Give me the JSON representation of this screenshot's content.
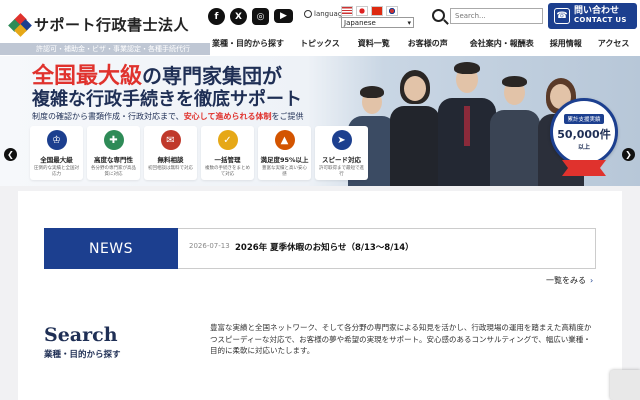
{
  "header": {
    "logo_text": "サポート行政書士法人",
    "sns": [
      {
        "name": "facebook",
        "glyph": "f"
      },
      {
        "name": "x",
        "glyph": "X"
      },
      {
        "name": "instagram",
        "glyph": "◎"
      },
      {
        "name": "youtube",
        "glyph": "▶"
      }
    ],
    "language_label": "language",
    "language_selected": "Japanese",
    "search_placeholder": "Search...",
    "contact_jp": "問い合わせ",
    "contact_en": "CONTACT US",
    "accent": "#1c3f8f"
  },
  "nav": [
    "業種・目的から探す",
    "トピックス",
    "資料一覧",
    "お客様の声",
    "会社案内・報酬表",
    "採用情報",
    "アクセス"
  ],
  "hero": {
    "scroll_text": "許認可・補助金・ビザ・事業認定・各種手続代行",
    "line1_red": "全国最大級",
    "line1_rest": "の専門家集団が",
    "line2": "複雑な行政手続きを徹底サポート",
    "sub_pre": "制度の確認から書類作成・行政対応まで、",
    "sub_hl": "安心して進められる体制",
    "sub_post": "をご提供",
    "features": [
      {
        "title": "全国最大級",
        "desc": "圧倒的な実績と全国対応力",
        "color": "#1c3f8f",
        "glyph": "♔"
      },
      {
        "title": "高度な専門性",
        "desc": "各分野の専門家が高品質に対応",
        "color": "#2e8b57",
        "glyph": "✚"
      },
      {
        "title": "無料相談",
        "desc": "初回相談は無料で対応",
        "color": "#c0392b",
        "glyph": "✉"
      },
      {
        "title": "一括管理",
        "desc": "複数の手続きをまとめて対応",
        "color": "#e6a817",
        "glyph": "✓"
      },
      {
        "title": "満足度95%以上",
        "desc": "豊富な実績と高い安心感",
        "color": "#d35400",
        "glyph": "▲"
      },
      {
        "title": "スピード対応",
        "desc": "許可取得まで最短で進行",
        "color": "#1c3f8f",
        "glyph": "➤"
      }
    ],
    "badge_top": "累計支援実績",
    "badge_num": "50,000件",
    "badge_bot": "以上",
    "prev": "❮",
    "next": "❯"
  },
  "news": {
    "label": "NEWS",
    "date": "2026-07-13",
    "title": "2026年 夏季休暇のお知らせ（8/13〜8/14）",
    "more": "一覧をみる",
    "more_chev": "›"
  },
  "search": {
    "heading": "Search",
    "sub": "業種・目的から探す",
    "desc": "豊富な実績と全国ネットワーク、そして各分野の専門家による知見を活かし、行政現場の運用を踏まえた高精度かつスピーディーな対応で、お客様の夢や希望の実現をサポート。安心感のあるコンサルティングで、幅広い業種・目的に柔軟に対応いたします。"
  }
}
